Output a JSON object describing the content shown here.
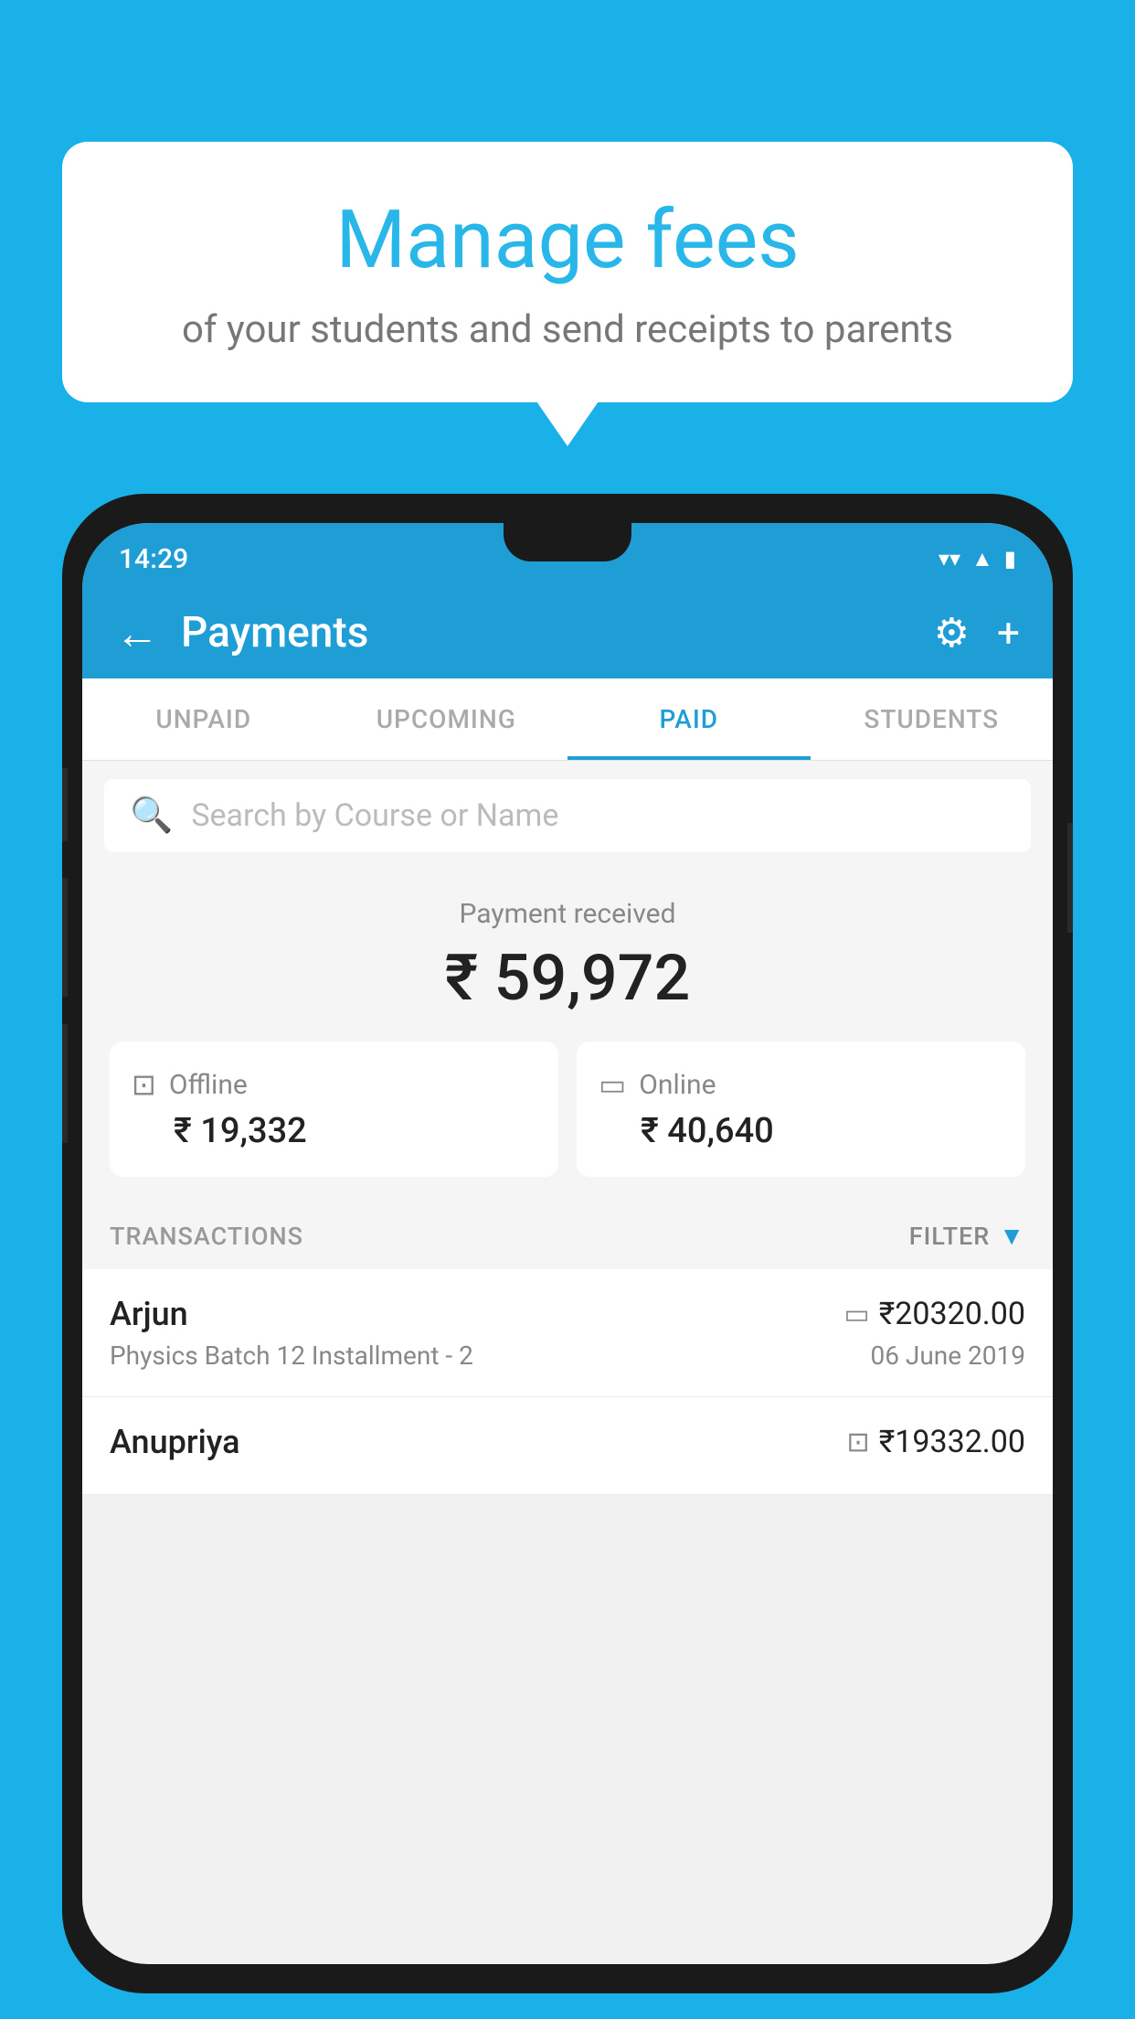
{
  "background_color": "#1ab0e8",
  "bubble": {
    "title": "Manage fees",
    "subtitle": "of your students and send receipts to parents"
  },
  "status_bar": {
    "time": "14:29",
    "wifi_icon": "▾",
    "signal_icon": "▲",
    "battery_icon": "▮"
  },
  "app_bar": {
    "title": "Payments",
    "back_label": "←",
    "gear_label": "⚙",
    "plus_label": "+"
  },
  "tabs": [
    {
      "label": "UNPAID",
      "active": false
    },
    {
      "label": "UPCOMING",
      "active": false
    },
    {
      "label": "PAID",
      "active": true
    },
    {
      "label": "STUDENTS",
      "active": false
    }
  ],
  "search": {
    "placeholder": "Search by Course or Name"
  },
  "payment_summary": {
    "received_label": "Payment received",
    "total_amount": "₹ 59,972",
    "offline": {
      "label": "Offline",
      "amount": "₹ 19,332"
    },
    "online": {
      "label": "Online",
      "amount": "₹ 40,640"
    }
  },
  "transactions": {
    "section_label": "TRANSACTIONS",
    "filter_label": "FILTER",
    "items": [
      {
        "name": "Arjun",
        "course": "Physics Batch 12 Installment - 2",
        "amount": "₹20320.00",
        "date": "06 June 2019",
        "type": "online"
      },
      {
        "name": "Anupriya",
        "course": "",
        "amount": "₹19332.00",
        "date": "",
        "type": "offline"
      }
    ]
  }
}
